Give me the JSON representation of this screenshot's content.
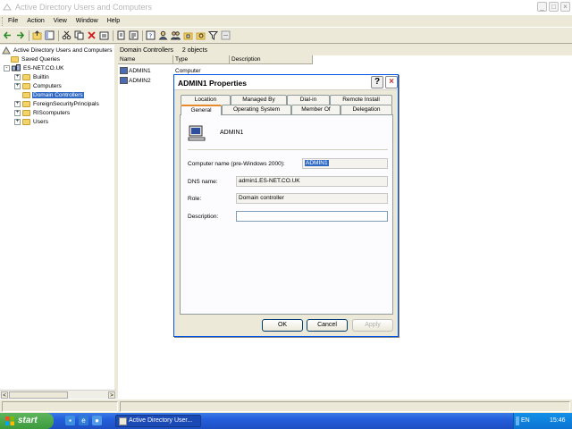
{
  "window": {
    "title": "Active Directory Users and Computers",
    "controls": [
      "_",
      "□",
      "×"
    ]
  },
  "menu": [
    "File",
    "Action",
    "View",
    "Window",
    "Help"
  ],
  "toolbar_icons": [
    "back-icon",
    "forward-icon",
    "up-icon",
    "show-tree-icon",
    "cut-icon",
    "delete-icon",
    "properties-icon",
    "refresh-icon",
    "export-icon",
    "help-icon",
    "new-user-icon",
    "new-group-icon",
    "new-ou-icon",
    "find-icon",
    "filter-icon",
    "delegate-icon"
  ],
  "tree": {
    "root": "Active Directory Users and Computers",
    "items": [
      {
        "label": "Saved Queries",
        "expander": "",
        "level": 1
      },
      {
        "label": "ES-NET.CO.UK",
        "expander": "-",
        "level": 1
      },
      {
        "label": "Builtin",
        "expander": "+",
        "level": 2
      },
      {
        "label": "Computers",
        "expander": "+",
        "level": 2
      },
      {
        "label": "Domain Controllers",
        "expander": "",
        "level": 2,
        "selected": true
      },
      {
        "label": "ForeignSecurityPrincipals",
        "expander": "+",
        "level": 2
      },
      {
        "label": "RIScomputers",
        "expander": "+",
        "level": 2
      },
      {
        "label": "Users",
        "expander": "+",
        "level": 2
      }
    ],
    "scroll_left": "<",
    "scroll_right": ">"
  },
  "right_pane": {
    "heading": "Domain Controllers",
    "count": "2 objects",
    "columns": [
      "Name",
      "Type",
      "Description"
    ],
    "rows": [
      {
        "name": "ADMIN1",
        "type": "Computer",
        "description": ""
      },
      {
        "name": "ADMIN2",
        "type": "",
        "description": ""
      }
    ]
  },
  "dialog": {
    "title": "ADMIN1 Properties",
    "help": "?",
    "close": "×",
    "tabs_row1": [
      "Location",
      "Managed By",
      "Dial-in",
      "Remote Install"
    ],
    "tabs_row2": [
      "General",
      "Operating System",
      "Member Of",
      "Delegation"
    ],
    "active_tab": "General",
    "object_name": "ADMIN1",
    "fields": {
      "pre2000_label": "Computer name (pre-Windows 2000):",
      "pre2000_value": "ADMIN1",
      "dns_label": "DNS name:",
      "dns_value": "admin1.ES-NET.CO.UK",
      "role_label": "Role:",
      "role_value": "Domain controller",
      "description_label": "Description:",
      "description_value": ""
    },
    "buttons": {
      "ok": "OK",
      "cancel": "Cancel",
      "apply": "Apply"
    }
  },
  "taskbar": {
    "start": "start",
    "task_label": "Active Directory User...",
    "language": "EN",
    "clock": "15:46"
  }
}
